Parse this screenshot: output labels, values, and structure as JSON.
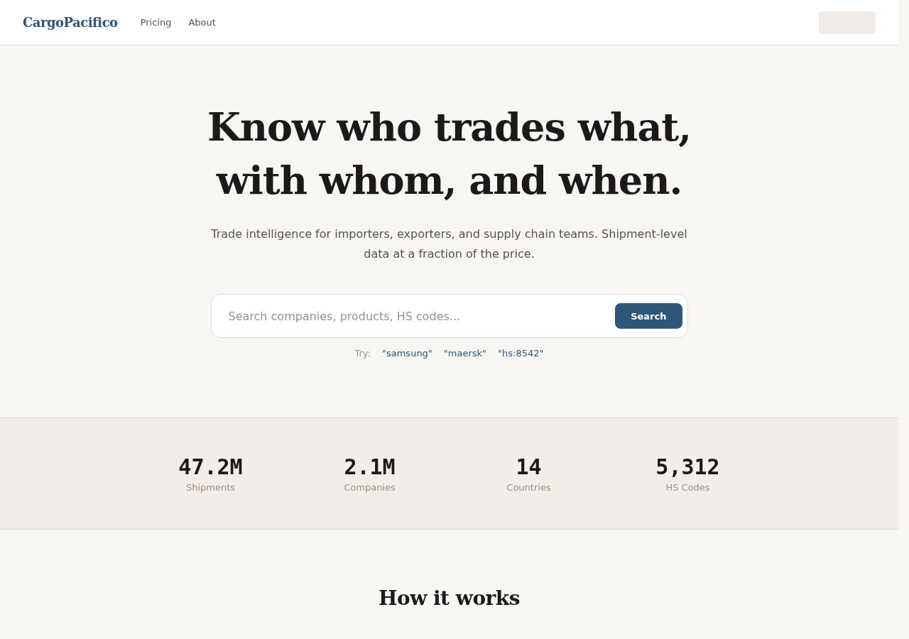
{
  "nav": {
    "logo": "CargoPacifico",
    "links": [
      "Pricing",
      "About"
    ]
  },
  "hero": {
    "title_lines": [
      "Know who trades what,",
      "with whom, and when."
    ],
    "subtitle": "Trade intelligence for importers, exporters, and supply chain teams. Shipment-level data at a fraction of the price.",
    "search": {
      "placeholder": "Search companies, products, HS codes...",
      "button": "Search"
    },
    "suggestions": {
      "label": "Try:",
      "items": [
        "\"samsung\"",
        "\"maersk\"",
        "\"hs:8542\""
      ]
    }
  },
  "stats": [
    {
      "value": "47.2M",
      "label": "Shipments"
    },
    {
      "value": "2.1M",
      "label": "Companies"
    },
    {
      "value": "14",
      "label": "Countries"
    },
    {
      "value": "5,312",
      "label": "HS Codes"
    }
  ],
  "how_it_works": {
    "title": "How it works"
  }
}
